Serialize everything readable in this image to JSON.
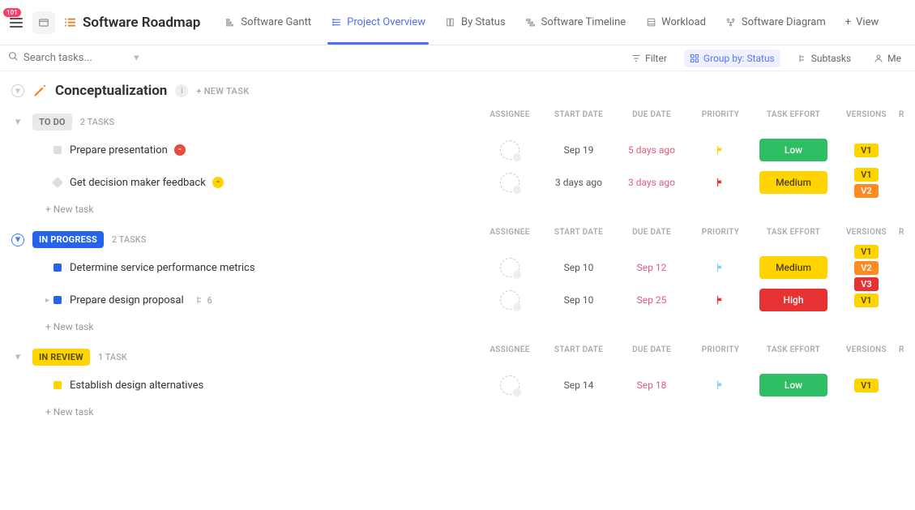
{
  "header": {
    "menu_badge": "101",
    "crumb_collapse_glyph": "…",
    "title": "Software Roadmap",
    "tabs": [
      {
        "label": "Software Gantt"
      },
      {
        "label": "Project Overview"
      },
      {
        "label": "By Status"
      },
      {
        "label": "Software Timeline"
      },
      {
        "label": "Workload"
      },
      {
        "label": "Software Diagram"
      }
    ],
    "active_tab_index": 1,
    "add_view_label": "View"
  },
  "toolbar": {
    "search_placeholder": "Search tasks...",
    "filter_label": "Filter",
    "group_label": "Group by: Status",
    "subtasks_label": "Subtasks",
    "me_label": "Me"
  },
  "section": {
    "title": "Conceptualization",
    "new_task_label": "+ NEW TASK"
  },
  "columns": {
    "assignee": "ASSIGNEE",
    "start": "START DATE",
    "due": "DUE DATE",
    "priority": "PRIORITY",
    "effort": "TASK EFFORT",
    "versions": "VERSIONS",
    "extra": "R"
  },
  "groups": [
    {
      "id": "todo",
      "label": "TO DO",
      "pill_class": "status-todo",
      "chevron_class": "",
      "count": "2 TASKS",
      "tasks": [
        {
          "sq": "sq-todo",
          "title": "Prepare presentation",
          "tag": "red",
          "tag_glyph": "−",
          "start": "Sep 19",
          "due": "5 days ago",
          "flag_color": "#ffd400",
          "effort_class": "effort-low",
          "effort_label": "Low",
          "versions": [
            {
              "cls": "v1",
              "label": "V1"
            }
          ]
        },
        {
          "sq": "sq-todo2",
          "title": "Get decision maker feedback",
          "tag": "yellow",
          "tag_glyph": "−",
          "start": "3 days ago",
          "due": "3 days ago",
          "flag_color": "#e63232",
          "effort_class": "effort-med",
          "effort_label": "Medium",
          "versions": [
            {
              "cls": "v1",
              "label": "V1"
            },
            {
              "cls": "v2",
              "label": "V2"
            }
          ]
        }
      ]
    },
    {
      "id": "progress",
      "label": "IN PROGRESS",
      "pill_class": "status-progress",
      "chevron_class": "progress",
      "count": "2 TASKS",
      "tasks": [
        {
          "sq": "sq-progress",
          "title": "Determine service performance metrics",
          "start": "Sep 10",
          "due": "Sep 12",
          "flag_color": "#7fd0ff",
          "effort_class": "effort-med",
          "effort_label": "Medium",
          "versions": [
            {
              "cls": "v1",
              "label": "V1"
            },
            {
              "cls": "v2",
              "label": "V2"
            },
            {
              "cls": "v3",
              "label": "V3"
            }
          ]
        },
        {
          "sq": "sq-progress",
          "title": "Prepare design proposal",
          "expand": "▸",
          "subtasks": "6",
          "start": "Sep 10",
          "due": "Sep 25",
          "flag_color": "#e63232",
          "effort_class": "effort-high",
          "effort_label": "High",
          "versions": [
            {
              "cls": "v1",
              "label": "V1"
            }
          ]
        }
      ]
    },
    {
      "id": "review",
      "label": "IN REVIEW",
      "pill_class": "status-review",
      "chevron_class": "",
      "count": "1 TASK",
      "tasks": [
        {
          "sq": "sq-review",
          "title": "Establish design alternatives",
          "start": "Sep 14",
          "due": "Sep 18",
          "flag_color": "#7fd0ff",
          "effort_class": "effort-low",
          "effort_label": "Low",
          "versions": [
            {
              "cls": "v1",
              "label": "V1"
            }
          ]
        }
      ]
    }
  ],
  "new_task_row": "+ New task"
}
